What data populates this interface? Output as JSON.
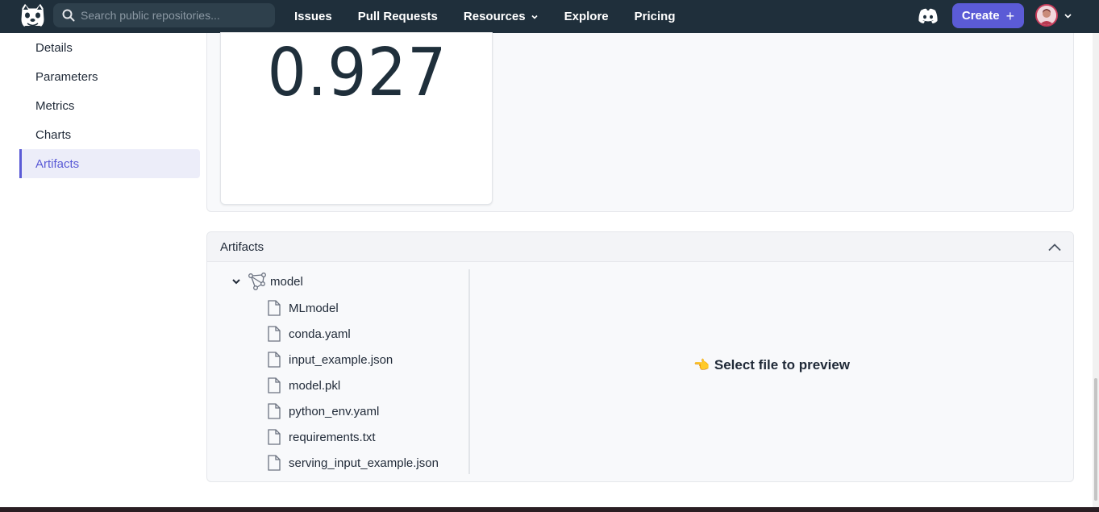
{
  "navbar": {
    "search_placeholder": "Search public repositories...",
    "links": [
      {
        "label": "Issues"
      },
      {
        "label": "Pull Requests"
      },
      {
        "label": "Resources",
        "has_dropdown": true
      },
      {
        "label": "Explore"
      },
      {
        "label": "Pricing"
      }
    ],
    "create_label": "Create",
    "create_icon": "+",
    "accent_color": "#5b5bd6",
    "background_color": "#1f2f3b"
  },
  "sidebar": {
    "items": [
      {
        "label": "Details"
      },
      {
        "label": "Parameters"
      },
      {
        "label": "Metrics"
      },
      {
        "label": "Charts"
      },
      {
        "label": "Artifacts",
        "active": true
      }
    ]
  },
  "metric": {
    "value": "0.927"
  },
  "artifacts": {
    "title": "Artifacts",
    "folder": {
      "label": "model",
      "expanded": true
    },
    "files": [
      {
        "label": "MLmodel"
      },
      {
        "label": "conda.yaml"
      },
      {
        "label": "input_example.json"
      },
      {
        "label": "model.pkl"
      },
      {
        "label": "python_env.yaml"
      },
      {
        "label": "requirements.txt"
      },
      {
        "label": "serving_input_example.json"
      }
    ],
    "preview_icon": "👈",
    "preview_message": "Select file to preview"
  }
}
